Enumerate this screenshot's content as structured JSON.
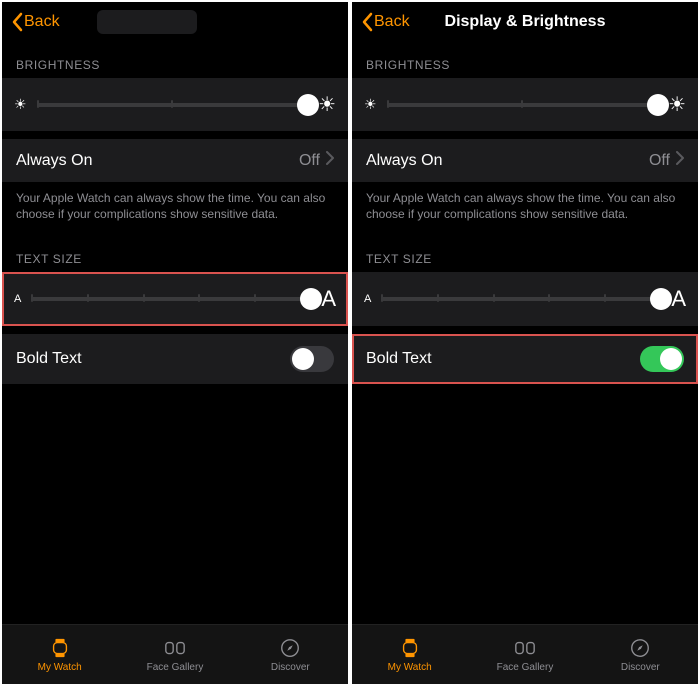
{
  "left": {
    "nav": {
      "back": "Back",
      "title": ""
    },
    "sections": {
      "brightness_header": "BRIGHTNESS",
      "always_on_label": "Always On",
      "always_on_value": "Off",
      "always_on_footer": "Your Apple Watch can always show the time. You can also choose if your complications show sensitive data.",
      "text_size_header": "TEXT SIZE",
      "bold_text_label": "Bold Text",
      "bold_text_on": false
    }
  },
  "right": {
    "nav": {
      "back": "Back",
      "title": "Display & Brightness"
    },
    "sections": {
      "brightness_header": "BRIGHTNESS",
      "always_on_label": "Always On",
      "always_on_value": "Off",
      "always_on_footer": "Your Apple Watch can always show the time. You can also choose if your complications show sensitive data.",
      "text_size_header": "TEXT SIZE",
      "bold_text_label": "Bold Text",
      "bold_text_on": true
    }
  },
  "icons": {
    "sun_small": "☀",
    "sun_big": "☀",
    "letter_small": "A",
    "letter_big": "A"
  },
  "tabs": {
    "my_watch": "My Watch",
    "face_gallery": "Face Gallery",
    "discover": "Discover"
  }
}
